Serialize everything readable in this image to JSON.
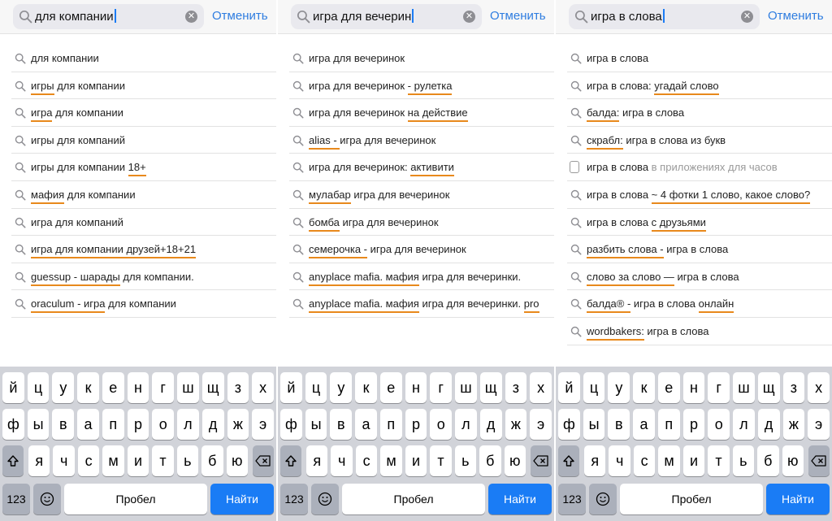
{
  "keyboard": {
    "row1": [
      "й",
      "ц",
      "у",
      "к",
      "е",
      "н",
      "г",
      "ш",
      "щ",
      "з",
      "х"
    ],
    "row2": [
      "ф",
      "ы",
      "в",
      "а",
      "п",
      "р",
      "о",
      "л",
      "д",
      "ж",
      "э"
    ],
    "row3": [
      "я",
      "ч",
      "с",
      "м",
      "и",
      "т",
      "ь",
      "б",
      "ю"
    ],
    "numbers_label": "123",
    "space_label": "Пробел",
    "search_label": "Найти"
  },
  "panels": [
    {
      "query": "для компании",
      "cancel_label": "Отменить",
      "suggestions": [
        [
          {
            "t": "для компании"
          }
        ],
        [
          {
            "t": "игры",
            "u": 1
          },
          {
            "t": " для компании"
          }
        ],
        [
          {
            "t": "игра",
            "u": 1
          },
          {
            "t": " для компании"
          }
        ],
        [
          {
            "t": "игры для компаний"
          }
        ],
        [
          {
            "t": "игры для компании "
          },
          {
            "t": "18+",
            "u": 1
          }
        ],
        [
          {
            "t": "мафия",
            "u": 1
          },
          {
            "t": " для компании"
          }
        ],
        [
          {
            "t": "игра для компаний"
          }
        ],
        [
          {
            "t": "игра для компании друзей+18+21",
            "u": 1
          }
        ],
        [
          {
            "t": "guessup - шарады",
            "u": 1
          },
          {
            "t": " для компании."
          }
        ],
        [
          {
            "t": "oraculum - игра",
            "u": 1
          },
          {
            "t": " для компании"
          }
        ]
      ]
    },
    {
      "query": "игра для вечерин",
      "cancel_label": "Отменить",
      "suggestions": [
        [
          {
            "t": "игра для вечеринок"
          }
        ],
        [
          {
            "t": "игра для вечеринок "
          },
          {
            "t": "- рулетка",
            "u": 1
          }
        ],
        [
          {
            "t": "игра для вечеринок "
          },
          {
            "t": "на действие",
            "u": 1
          }
        ],
        [
          {
            "t": "alias - ",
            "u": 1
          },
          {
            "t": "игра для вечеринок"
          }
        ],
        [
          {
            "t": "игра для вечеринок: "
          },
          {
            "t": "активити",
            "u": 1
          }
        ],
        [
          {
            "t": "мулабар",
            "u": 1
          },
          {
            "t": " игра для вечеринок"
          }
        ],
        [
          {
            "t": "бомба",
            "u": 1
          },
          {
            "t": " игра для вечеринок"
          }
        ],
        [
          {
            "t": "семерочка -",
            "u": 1
          },
          {
            "t": " игра для вечеринок"
          }
        ],
        [
          {
            "t": "anyplace mafia. мафия",
            "u": 1
          },
          {
            "t": " игра для вечеринки."
          }
        ],
        [
          {
            "t": "anyplace mafia. мафия",
            "u": 1
          },
          {
            "t": " игра для вечеринки. "
          },
          {
            "t": "pro",
            "u": 1
          }
        ]
      ]
    },
    {
      "query": "игра в слова",
      "cancel_label": "Отменить",
      "suggestions": [
        [
          {
            "t": "игра в слова"
          }
        ],
        [
          {
            "t": "игра в слова: "
          },
          {
            "t": "угадай слово",
            "u": 1
          }
        ],
        [
          {
            "t": "балда:",
            "u": 1
          },
          {
            "t": " игра в слова"
          }
        ],
        [
          {
            "t": "скрабл:",
            "u": 1
          },
          {
            "t": " игра в слова из букв"
          }
        ],
        [
          {
            "t": "игра в слова"
          },
          {
            "t": " в приложениях для часов",
            "m": 1
          }
        ],
        [
          {
            "t": "игра в слова "
          },
          {
            "t": "~ 4 фотки 1 слово, какое слово?",
            "u": 1
          }
        ],
        [
          {
            "t": "игра в слова "
          },
          {
            "t": "с друзьями",
            "u": 1
          }
        ],
        [
          {
            "t": "разбить слова -",
            "u": 1
          },
          {
            "t": " игра в слова"
          }
        ],
        [
          {
            "t": "слово за слово —",
            "u": 1
          },
          {
            "t": " игра в слова"
          }
        ],
        [
          {
            "t": "балда® -",
            "u": 1
          },
          {
            "t": " игра в слова "
          },
          {
            "t": "онлайн",
            "u": 1
          }
        ],
        [
          {
            "t": "wordbakers:",
            "u": 1
          },
          {
            "t": " игра в слова"
          }
        ]
      ]
    }
  ]
}
